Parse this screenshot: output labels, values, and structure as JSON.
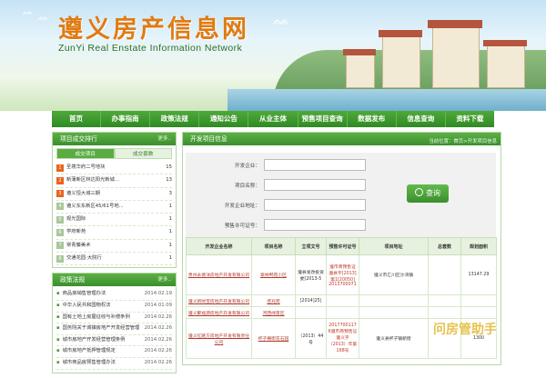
{
  "header": {
    "title_cn": "遵义房产信息网",
    "title_en": "ZunYi  Real Enstate  Information Network"
  },
  "nav": [
    {
      "label": "首页"
    },
    {
      "label": "办事指南"
    },
    {
      "label": "政策法规"
    },
    {
      "label": "通知公告"
    },
    {
      "label": "从业主体"
    },
    {
      "label": "预售项目查询"
    },
    {
      "label": "数据发布"
    },
    {
      "label": "信息查询"
    },
    {
      "label": "资料下载"
    }
  ],
  "ranking": {
    "title": "项目成交排行",
    "more": "更多..",
    "tabs": [
      {
        "label": "成交项目"
      },
      {
        "label": "成交套数"
      }
    ],
    "rows": [
      {
        "no": "1",
        "name": "圣境华府二号地块",
        "count": "15"
      },
      {
        "no": "2",
        "name": "新蒲新区林达阳光新城...",
        "count": "13"
      },
      {
        "no": "3",
        "name": "遵义恒大城三期",
        "count": "3"
      },
      {
        "no": "4",
        "name": "遵义东东新区45/61号地...",
        "count": "1"
      },
      {
        "no": "5",
        "name": "观光国际",
        "count": "1"
      },
      {
        "no": "6",
        "name": "学府新苑",
        "count": "1"
      },
      {
        "no": "7",
        "name": "常青藤美术",
        "count": "1"
      },
      {
        "no": "8",
        "name": "交通花园·大院行",
        "count": "1"
      }
    ]
  },
  "policy": {
    "title": "政策法规",
    "more": "更多..",
    "items": [
      {
        "title": "商品房销售管理办法",
        "date": "2014.02.19"
      },
      {
        "title": "中华人民共和国物权法",
        "date": "2014.01.09"
      },
      {
        "title": "国有土地上房屋征收与补偿条例",
        "date": "2014.02.26"
      },
      {
        "title": "国务院关于城镇房地产开发经营管理",
        "date": "2014.02.26"
      },
      {
        "title": "城市房地产开发经营管理条例",
        "date": "2014.02.26"
      },
      {
        "title": "城市房地产抵押管理规定",
        "date": "2014.02.26"
      },
      {
        "title": "城市商品房预售管理办法",
        "date": "2014.02.26"
      }
    ]
  },
  "main": {
    "title": "开发项目信息",
    "breadcrumb": "当前位置：首页>开发项目信息",
    "search": {
      "developer_label": "开发企业：",
      "project_label": "项目名称：",
      "address_label": "开发企业地址：",
      "permit_label": "预售许可证号：",
      "button_label": "查询"
    },
    "table": {
      "headers": [
        "开发企业名称",
        "项目名称",
        "立项文号",
        "预售许可证号",
        "项目地址",
        "总套数",
        "规划面积"
      ],
      "rows": [
        {
          "developer": "贵州永德洋房地产开发有限公司",
          "project": "紫林鸭苑小区",
          "approval": "遵县发改投资委[2013-5",
          "permit": "遵市商预售证遵县字[2013]第1[20050] 2013700071",
          "address": "遵义市汇川区沙湾镇",
          "units": "",
          "area": "13147.29"
        },
        {
          "developer": "遵义新财宝房地产开发有限公司",
          "project": "佳兆苑",
          "approval": "[2014]25|",
          "permit": "",
          "address": "",
          "units": "",
          "area": ""
        },
        {
          "developer": "遵义聚福源房地产开发有限公司",
          "project": "河西绿景区",
          "approval": "",
          "permit": "",
          "address": "",
          "units": "",
          "area": ""
        },
        {
          "developer": "遵义红路方房地产开发有限责任公司",
          "project": "杯子横街花石园",
          "approval": "（2013）44号",
          "permit": "2017700117 6遵市商预售证遵义字（2013）年第168号",
          "address": "遵义县杯子镇新街",
          "units": "",
          "area": "1300"
        }
      ]
    }
  },
  "watermark": "问房管助手"
}
